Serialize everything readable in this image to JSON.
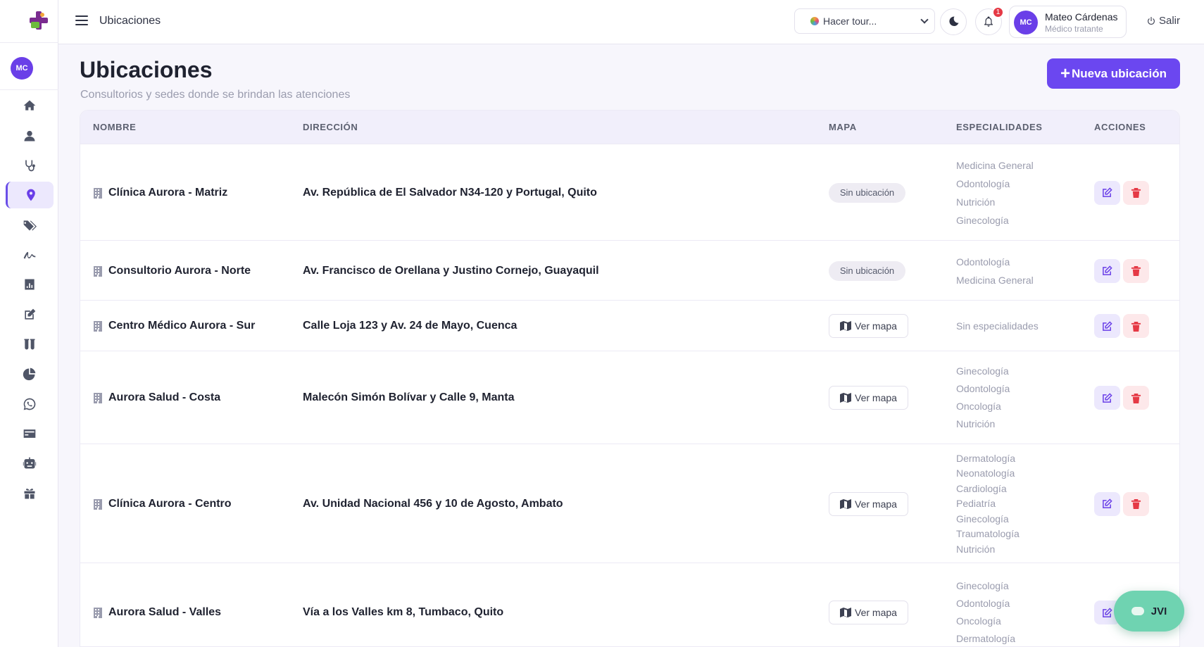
{
  "sidebar": {
    "avatar_initials": "MC",
    "items": [
      {
        "icon": "home-icon",
        "active": false
      },
      {
        "icon": "user-icon",
        "active": false
      },
      {
        "icon": "stethoscope-icon",
        "active": false
      },
      {
        "icon": "location-pin-icon",
        "active": true
      },
      {
        "icon": "tags-icon",
        "active": false
      },
      {
        "icon": "signature-icon",
        "active": false
      },
      {
        "icon": "bar-chart-icon",
        "active": false
      },
      {
        "icon": "edit-icon",
        "active": false
      },
      {
        "icon": "test-tubes-icon",
        "active": false
      },
      {
        "icon": "pie-chart-icon",
        "active": false
      },
      {
        "icon": "whatsapp-icon",
        "active": false
      },
      {
        "icon": "credit-card-icon",
        "active": false
      },
      {
        "icon": "robot-icon",
        "active": false
      },
      {
        "icon": "gift-icon",
        "active": false
      }
    ]
  },
  "topbar": {
    "title": "Ubicaciones",
    "tour_label": "Hacer tour...",
    "notifications_count": "1",
    "user_initials": "MC",
    "user_name": "Mateo Cárdenas",
    "user_role": "Médico tratante",
    "logout_label": "Salir"
  },
  "page": {
    "title": "Ubicaciones",
    "subtitle": "Consultorios y sedes donde se brindan las atenciones",
    "new_button_label": "Nueva ubicación"
  },
  "table": {
    "headers": {
      "name": "NOMBRE",
      "address": "DIRECCIÓN",
      "map": "MAPA",
      "specialties": "ESPECIALIDADES",
      "actions": "ACCIONES"
    },
    "rows": [
      {
        "name": "Clínica Aurora - Matriz",
        "address": "Av. República de El Salvador N34-120 y Portugal, Quito",
        "map": "Sin ubicación",
        "specialties": [
          "Medicina General",
          "Odontología",
          "Nutrición",
          "Ginecología"
        ]
      },
      {
        "name": "Consultorio Aurora - Norte",
        "address": "Av. Francisco de Orellana y Justino Cornejo, Guayaquil",
        "map": "Sin ubicación",
        "specialties": [
          "Odontología",
          "Medicina General"
        ]
      },
      {
        "name": "Centro Médico Aurora - Sur",
        "address": "Calle Loja 123 y Av. 24 de Mayo, Cuenca",
        "map": "Ver mapa",
        "specialties": [
          "Sin especialidades"
        ]
      },
      {
        "name": "Aurora Salud - Costa",
        "address": "Malecón Simón Bolívar y Calle 9, Manta",
        "map": "Ver mapa",
        "specialties": [
          "Ginecología",
          "Odontología",
          "Oncología",
          "Nutrición"
        ]
      },
      {
        "name": "Clínica Aurora - Centro",
        "address": "Av. Unidad Nacional 456 y 10 de Agosto, Ambato",
        "map": "Ver mapa",
        "specialties": [
          "Dermatología",
          "Neonatología",
          "Cardiología",
          "Pediatría",
          "Ginecología",
          "Traumatología",
          "Nutrición"
        ]
      },
      {
        "name": "Aurora Salud - Valles",
        "address": "Vía a los Valles km 8, Tumbaco, Quito",
        "map": "Ver mapa",
        "specialties": [
          "Ginecología",
          "Odontología",
          "Oncología",
          "Dermatología"
        ]
      }
    ]
  },
  "chat_widget": {
    "label": "JVI"
  },
  "colors": {
    "accent": "#6b47f0",
    "danger": "#e53945",
    "chat": "#6fd3b1"
  }
}
